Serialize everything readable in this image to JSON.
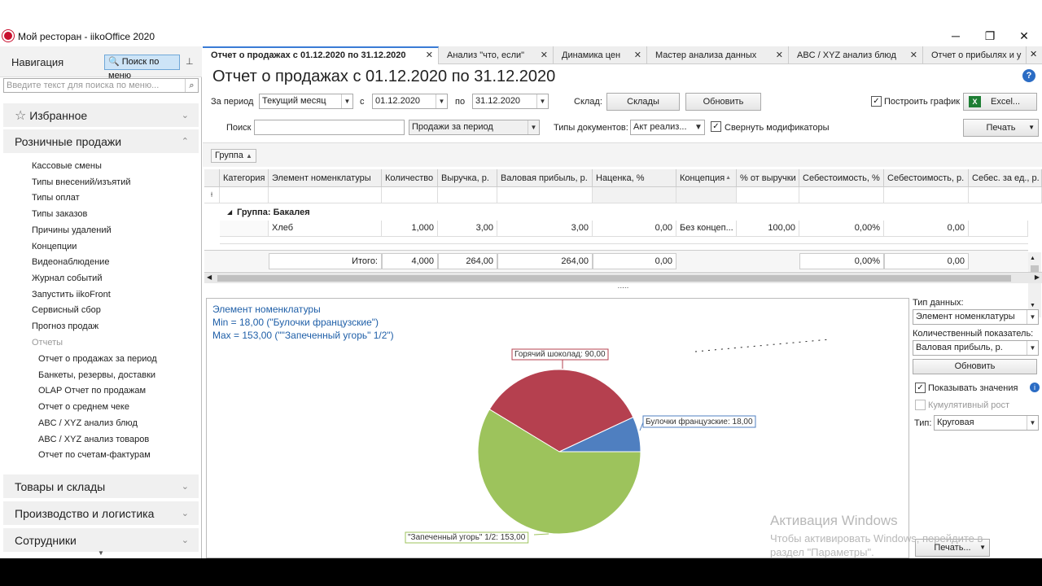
{
  "window": {
    "title": "Мой ресторан - iikoOffice 2020",
    "controls": [
      "─",
      "❐",
      "✕"
    ]
  },
  "nav": {
    "header": "Навигация",
    "search_button": "Поиск по меню",
    "search_placeholder": "Введите текст для поиска по меню...",
    "favorites": "Избранное",
    "retail": "Розничные продажи",
    "retail_items": [
      "Кассовые смены",
      "Типы внесений/изъятий",
      "Типы оплат",
      "Типы заказов",
      "Причины удалений",
      "Концепции",
      "Видеонаблюдение",
      "Журнал событий",
      "Запустить iikoFront",
      "Сервисный сбор",
      "Прогноз продаж",
      "Отчеты"
    ],
    "report_items": [
      "Отчет о продажах за период",
      "Банкеты, резервы, доставки",
      "OLAP Отчет по продажам",
      "Отчет о среднем чеке",
      "ABC / XYZ анализ блюд",
      "ABC / XYZ анализ товаров",
      "Отчет по счетам-фактурам"
    ],
    "goods": "Товары и склады",
    "production": "Производство и логистика",
    "staff": "Сотрудники"
  },
  "tabs": [
    {
      "label": "Отчет о продажах с 01.12.2020 по 31.12.2020",
      "active": true
    },
    {
      "label": "Анализ \"что, если\""
    },
    {
      "label": "Динамика цен"
    },
    {
      "label": "Мастер анализа данных"
    },
    {
      "label": "ABC / XYZ анализ блюд"
    },
    {
      "label": "Отчет о прибылях и у"
    }
  ],
  "report": {
    "title": "Отчет о продажах с 01.12.2020 по 31.12.2020",
    "period_label": "За период",
    "period_value": "Текущий месяц",
    "from_label": "с",
    "from_value": "01.12.2020",
    "to_label": "по",
    "to_value": "31.12.2020",
    "warehouse_label": "Склад:",
    "warehouse_button": "Склады",
    "refresh_button": "Обновить",
    "build_chart": "Построить график",
    "excel_button": "Excel...",
    "search_label": "Поиск",
    "search_value": "",
    "report_type": "Продажи за период",
    "doc_types_label": "Типы документов:",
    "doc_types_value": "Акт реализ...",
    "collapse_mods": "Свернуть модификаторы",
    "print_button": "Печать",
    "group_chip": "Группа"
  },
  "grid": {
    "columns": [
      "Категория",
      "Элемент номенклатуры",
      "Количество",
      "Выручка, р.",
      "Валовая прибыль, р.",
      "Наценка, %",
      "Концепция",
      "% от выручки",
      "Себестоимость, %",
      "Себестоимость, р.",
      "Себес. за ед., р."
    ],
    "group_row": "Группа: Бакалея",
    "row1": {
      "item": "Хлеб",
      "qty": "1,000",
      "revenue": "3,00",
      "gross": "3,00",
      "markup": "0,00",
      "concept": "Без концеп...",
      "pct": "100,00",
      "cost_pct": "0,00%",
      "cost": "0,00"
    },
    "totals": {
      "label": "Итого:",
      "qty": "4,000",
      "revenue": "264,00",
      "gross": "264,00",
      "markup": "0,00",
      "cost_pct": "0,00%",
      "cost": "0,00"
    },
    "splitter": "....."
  },
  "chart_header": {
    "line1": "Элемент номенклатуры",
    "line2": "Min = 18,00 (\"Булочки французские\")",
    "line3": "Max = 153,00 (\"\"Запеченный угорь\" 1/2\")"
  },
  "chart_data": {
    "type": "pie",
    "categories": [
      "Горячий шоколад",
      "Булочки французские",
      "\"Запеченный угорь\" 1/2"
    ],
    "values": [
      90,
      18,
      153
    ],
    "labels": [
      "Горячий шоколад: 90,00",
      "Булочки французские: 18,00",
      "\"Запеченный угорь\" 1/2: 153,00"
    ],
    "colors": [
      "#b5404f",
      "#4f7fc0",
      "#9dc35c"
    ]
  },
  "side": {
    "data_type_label": "Тип данных:",
    "data_type_value": "Элемент номенклатуры",
    "metric_label": "Количественный показатель:",
    "metric_value": "Валовая прибыль, р.",
    "refresh_button": "Обновить",
    "show_values": "Показывать значения",
    "cumulative": "Кумулятивный рост",
    "type_label": "Тип:",
    "type_value": "Круговая",
    "print_button": "Печать..."
  },
  "watermark": {
    "line1": "Активация Windows",
    "line2": "Чтобы активировать Windows, перейдите в",
    "line3": "раздел \"Параметры\"."
  }
}
